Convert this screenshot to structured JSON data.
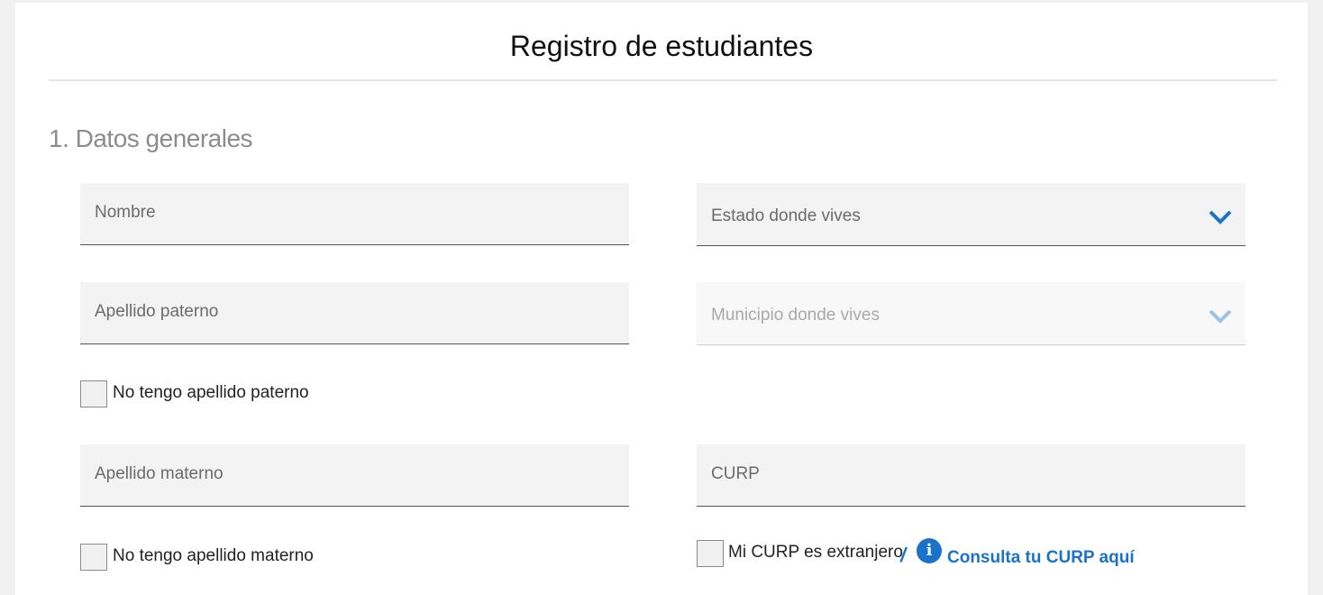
{
  "page": {
    "title": "Registro de estudiantes"
  },
  "section": {
    "title": "1. Datos generales"
  },
  "fields": {
    "nombre": "Nombre",
    "estado": "Estado donde vives",
    "apellido_paterno": "Apellido paterno",
    "municipio": "Municipio donde vives",
    "apellido_materno": "Apellido materno",
    "curp": "CURP"
  },
  "checkboxes": {
    "sin_paterno": "No tengo apellido paterno",
    "sin_materno": "No tengo apellido materno",
    "curp_extranjero": "Mi CURP es extranjero"
  },
  "links": {
    "separator": "/",
    "info_icon_glyph": "i",
    "consulta_curp": "Consulta tu CURP aquí"
  },
  "colors": {
    "accent": "#1a73c9",
    "accent_disabled": "#9cc3e6",
    "field_bg": "#f3f3f3"
  },
  "icons": {
    "select_arrow": "chevron-down-icon",
    "info": "info-icon"
  }
}
